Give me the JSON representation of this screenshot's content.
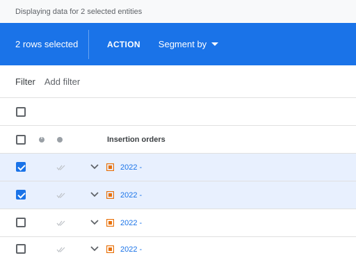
{
  "info_bar": {
    "text": "Displaying data for 2 selected entities"
  },
  "action_bar": {
    "selected_text": "2 rows selected",
    "action_label": "ACTION",
    "segment_label": "Segment by"
  },
  "filter_bar": {
    "label": "Filter",
    "add_filter": "Add filter"
  },
  "table": {
    "column_header": "Insertion orders",
    "rows": [
      {
        "name": "2022 -",
        "checked": true
      },
      {
        "name": "2022 -",
        "checked": true
      },
      {
        "name": "2022 -",
        "checked": false
      },
      {
        "name": "2022 -",
        "checked": false
      }
    ]
  },
  "colors": {
    "accent": "#1a73e8",
    "selected_row": "#e8f0fe",
    "io_icon": "#e8710a"
  },
  "icons": [
    "chevron-down-icon",
    "double-check-icon",
    "insertion-order-icon",
    "warning-icon",
    "status-dot-icon"
  ]
}
